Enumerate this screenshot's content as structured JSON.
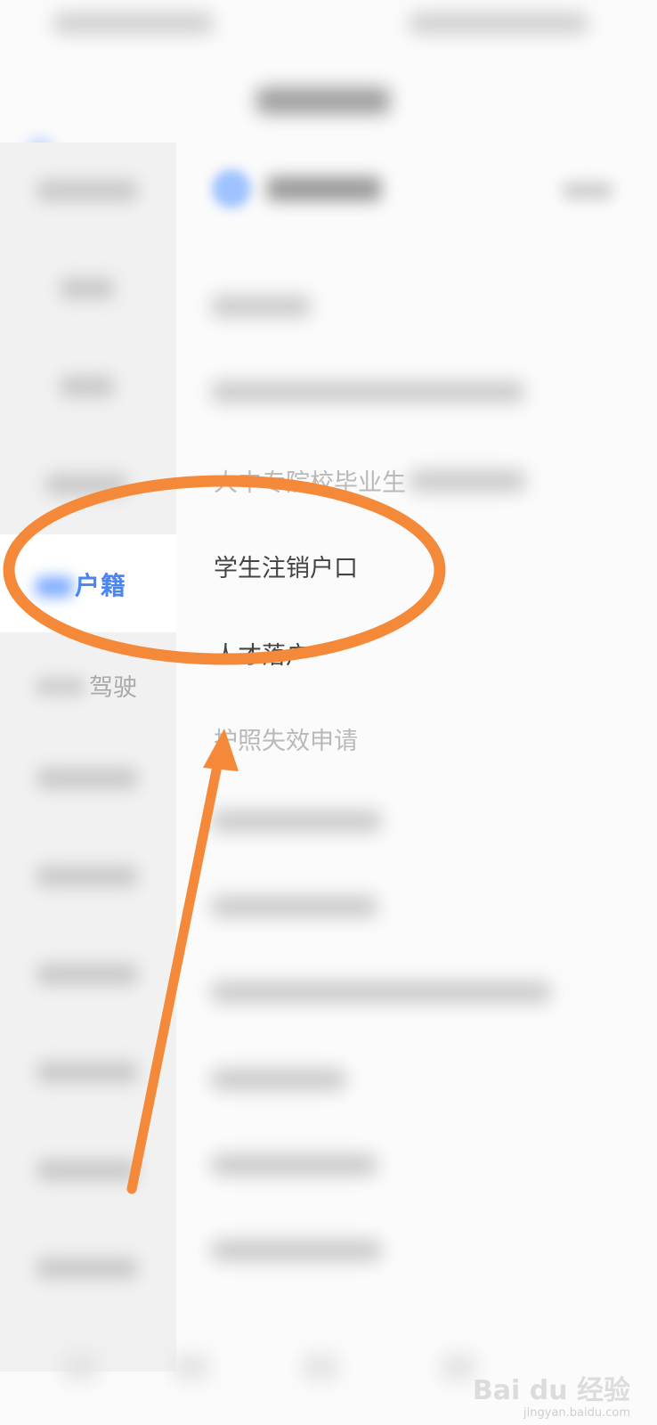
{
  "sidebar": {
    "active_item": "户籍",
    "drive_item": "驾驶"
  },
  "content": {
    "row_graduate": "大中专院校毕业生",
    "row_student_cancel": "学生注销户口",
    "row_talent": "人才落户",
    "row_passport": "护照失效申请"
  },
  "annotation": {
    "color": "#f5893a"
  },
  "watermark": {
    "brand": "Bai du 经验",
    "url": "jingyan.baidu.com"
  }
}
